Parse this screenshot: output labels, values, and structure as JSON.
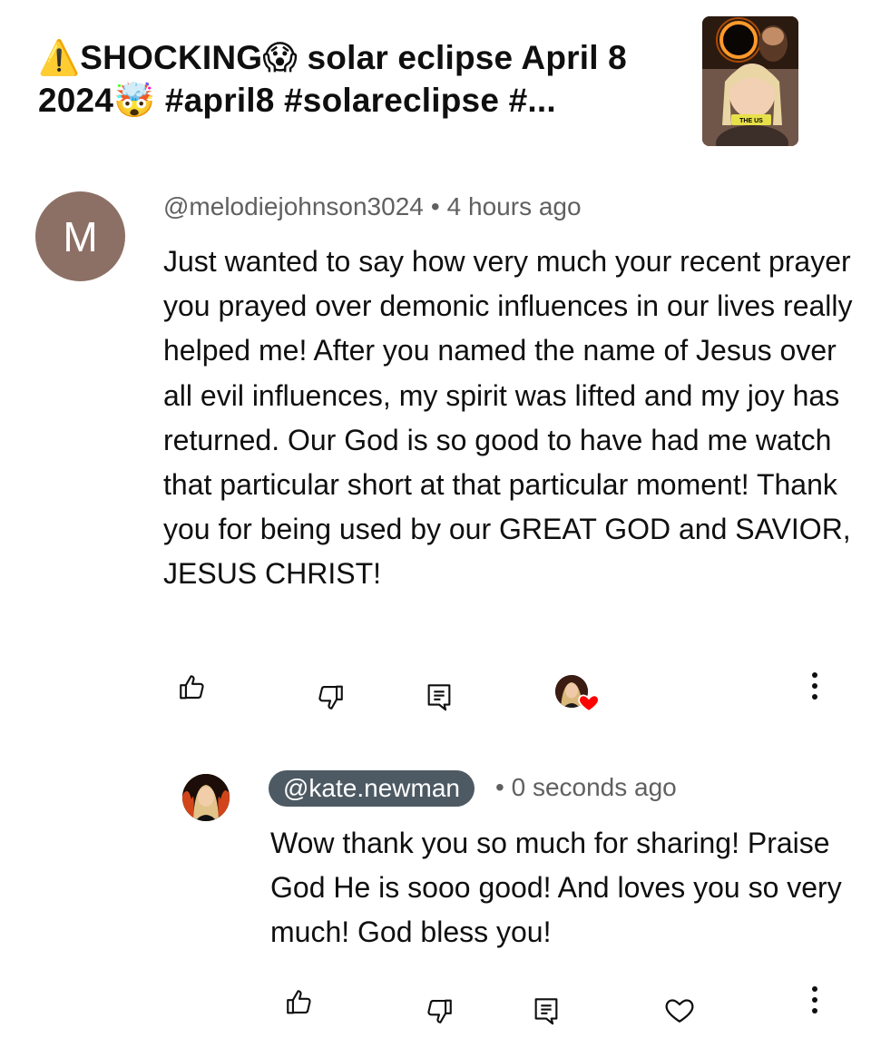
{
  "video": {
    "title": "⚠️SHOCKING😱 solar eclipse April 8 2024🤯 #april8 #solareclipse #...",
    "thumbnail_caption": "THE US"
  },
  "comment": {
    "avatar_letter": "M",
    "author": "@melodiejohnson3024",
    "separator": "•",
    "time": "4 hours ago",
    "text": "Just wanted to say how very much your recent prayer you prayed over demonic influences in our lives really helped me! After you named the name of Jesus over all evil influences, my spirit was lifted and my joy has returned. Our God is so good to have had me watch that particular short at that particular moment! Thank you for being used by our GREAT GOD and SAVIOR, JESUS CHRIST!",
    "actions": {
      "like_icon": "thumb-up-icon",
      "dislike_icon": "thumb-down-icon",
      "reply_icon": "reply-icon",
      "creator_heart_icon": "creator-heart-icon",
      "more_icon": "more-vertical-icon"
    }
  },
  "reply": {
    "author": "@kate.newman",
    "separator": "•",
    "time": "0 seconds ago",
    "text": "Wow thank you so much for sharing! Praise God He is sooo good! And loves you so very much! God bless you!",
    "actions": {
      "like_icon": "thumb-up-icon",
      "dislike_icon": "thumb-down-icon",
      "reply_icon": "reply-icon",
      "heart_icon": "heart-outline-icon",
      "more_icon": "more-vertical-icon"
    }
  },
  "colors": {
    "meta_text": "#606060",
    "handle_pill": "#4e5a63",
    "avatar_m": "#8d7065",
    "heart_red": "#ff0000",
    "text": "#0f0f0f"
  }
}
